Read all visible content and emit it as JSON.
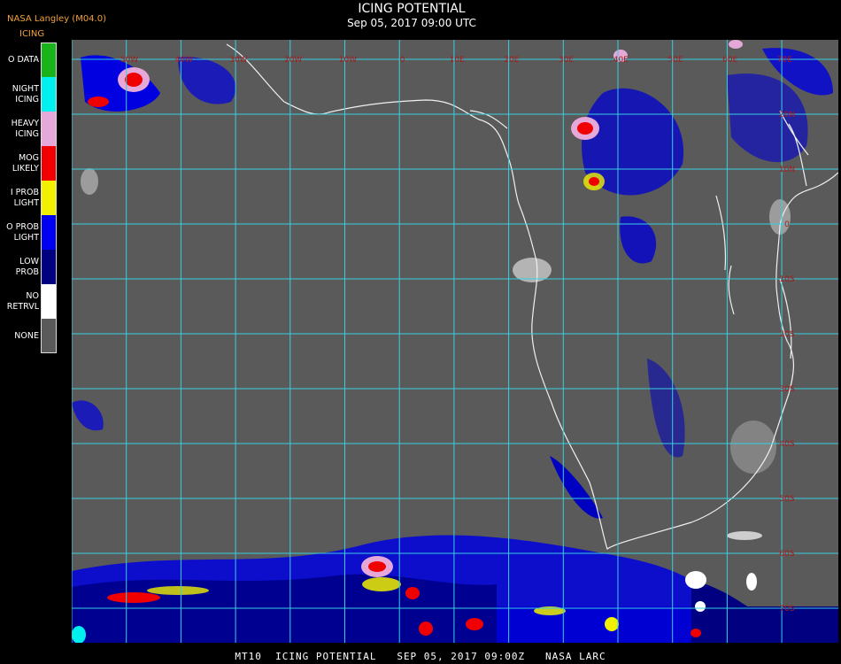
{
  "header": {
    "organization": "NASA Langley (M04.0)",
    "product": "ICING",
    "title": "ICING POTENTIAL",
    "subtitle": "Sep 05, 2017 09:00 UTC"
  },
  "legend": [
    {
      "label": "O DATA",
      "color": "#19b419"
    },
    {
      "label": "NIGHT\nICING",
      "color": "#00f0f0"
    },
    {
      "label": "HEAVY\nICING",
      "color": "#e6a8d8"
    },
    {
      "label": "MOG\nLIKELY",
      "color": "#f00000"
    },
    {
      "label": "I PROB\nLIGHT",
      "color": "#f0f000"
    },
    {
      "label": "O PROB\nLIGHT",
      "color": "#0000f0"
    },
    {
      "label": "LOW\nPROB",
      "color": "#000080"
    },
    {
      "label": "NO\nRETRVL",
      "color": "#ffffff"
    },
    {
      "label": "NONE",
      "color": "#5a5a5a"
    }
  ],
  "map": {
    "background": "#5a5a5a",
    "grid_color": "#38d0e0",
    "coastline_color": "#f0f0f0",
    "grid_label_color": "#b01818",
    "top_labels": [
      "50W",
      "40W",
      "30W",
      "20W",
      "10W",
      "0",
      "10E",
      "20E",
      "30E",
      "40E",
      "50E",
      "60E",
      "70E"
    ],
    "right_labels": [
      "20N",
      "10N",
      "0",
      "10S",
      "20S",
      "30S",
      "40S",
      "50S",
      "60S",
      "70S"
    ]
  },
  "footer": {
    "text": "MT10  ICING POTENTIAL   SEP 05, 2017 09:00Z   NASA LARC"
  }
}
